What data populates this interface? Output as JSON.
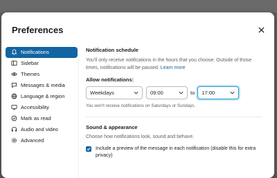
{
  "dialog": {
    "title": "Preferences"
  },
  "sidebar": {
    "items": [
      {
        "label": "Notifications",
        "icon": "bell-icon",
        "active": true
      },
      {
        "label": "Sidebar",
        "icon": "sidebar-icon"
      },
      {
        "label": "Themes",
        "icon": "eye-icon"
      },
      {
        "label": "Messages & media",
        "icon": "chat-bubble-icon"
      },
      {
        "label": "Language & region",
        "icon": "globe-icon"
      },
      {
        "label": "Accessibility",
        "icon": "screen-icon"
      },
      {
        "label": "Mark as read",
        "icon": "check-circle-icon"
      },
      {
        "label": "Audio and video",
        "icon": "headphones-icon"
      },
      {
        "label": "Advanced",
        "icon": "gear-icon"
      }
    ]
  },
  "schedule": {
    "title": "Notification schedule",
    "description": "You'll only receive notifications in the hours that you choose. Outside of those times, notifications will be paused.",
    "learn_more": "Learn more",
    "allow_label": "Allow notifications:",
    "days_value": "Weekdays",
    "from_value": "09:00",
    "to_label": "to",
    "to_value": "17:00",
    "hint": "You won't receive notifications on Saturdays or Sundays."
  },
  "sound": {
    "title": "Sound & appearance",
    "description": "Choose how notifications look, sound and behave.",
    "preview_checkbox_label": "Include a preview of the message in each notification (disable this for extra privacy)",
    "preview_checked": true
  },
  "colors": {
    "accent": "#1264a3",
    "focus": "#1d9bd1"
  }
}
